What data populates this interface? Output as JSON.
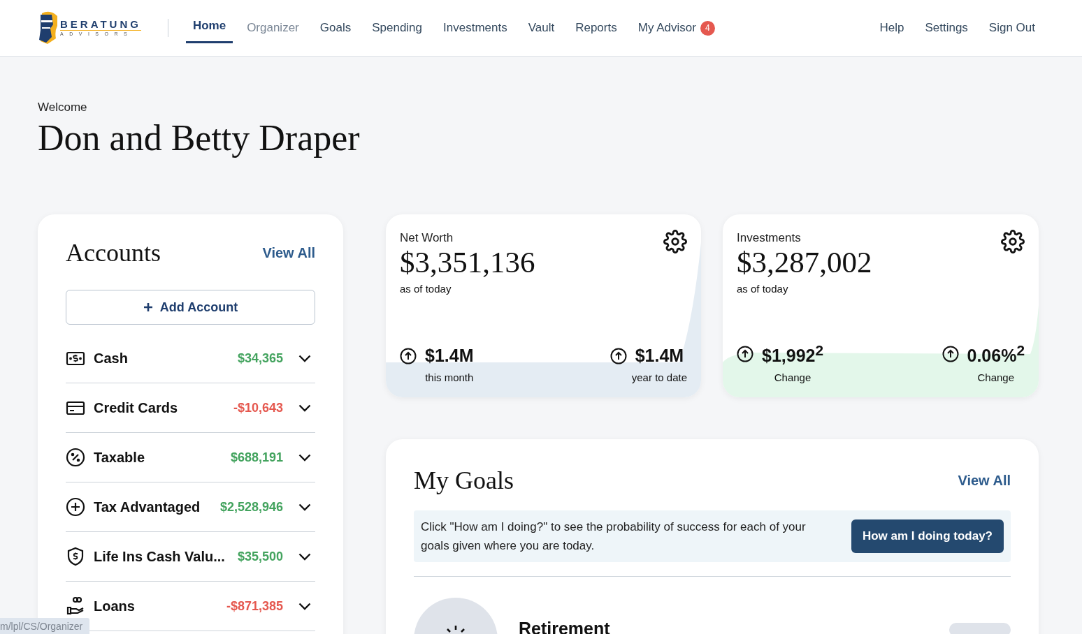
{
  "logo": {
    "name": "BERATUNG",
    "tagline": "ADVISORS"
  },
  "nav": [
    {
      "label": "Home",
      "selected": true,
      "hovered": false
    },
    {
      "label": "Organizer",
      "selected": false,
      "hovered": true
    },
    {
      "label": "Goals",
      "selected": false,
      "hovered": false
    },
    {
      "label": "Spending",
      "selected": false,
      "hovered": false
    },
    {
      "label": "Investments",
      "selected": false,
      "hovered": false
    },
    {
      "label": "Vault",
      "selected": false,
      "hovered": false
    },
    {
      "label": "Reports",
      "selected": false,
      "hovered": false
    },
    {
      "label": "My Advisor",
      "selected": false,
      "hovered": false,
      "badge": "4"
    }
  ],
  "nav_right": [
    "Help",
    "Settings",
    "Sign Out"
  ],
  "welcome": "Welcome",
  "household": "Don and Betty Draper",
  "accounts": {
    "title": "Accounts",
    "view_all": "View All",
    "add_button": "Add Account",
    "rows": [
      {
        "kind": "cash",
        "name": "Cash",
        "amount": "$34,365",
        "color": "#43a35e",
        "expanded": false
      },
      {
        "kind": "card",
        "name": "Credit Cards",
        "amount": "-$10,643",
        "color": "#e5584f",
        "expanded": false
      },
      {
        "kind": "taxable",
        "name": "Taxable",
        "amount": "$688,191",
        "color": "#43a35e",
        "expanded": false
      },
      {
        "kind": "advantaged",
        "name": "Tax Advantaged",
        "amount": "$2,528,946",
        "color": "#43a35e",
        "expanded": false
      },
      {
        "kind": "insurance",
        "name": "Life Ins Cash Valu...",
        "amount": "$35,500",
        "color": "#43a35e",
        "expanded": false
      },
      {
        "kind": "loan",
        "name": "Loans",
        "amount": "-$871,385",
        "color": "#e5584f",
        "expanded": false
      }
    ]
  },
  "summary_cards": [
    {
      "kind": "networth",
      "title": "Net Worth",
      "value": "$3,351,136",
      "note": "as of today",
      "stats": [
        {
          "value": "$1.4M",
          "label": "this month"
        },
        {
          "value": "$1.4M",
          "label": "year to date"
        }
      ]
    },
    {
      "kind": "investments",
      "title": "Investments",
      "value": "$3,287,002",
      "note": "as of today",
      "stats": [
        {
          "value": "$1,992$^{2}$",
          "label": "Change"
        },
        {
          "value": "0.06%$^{2}$",
          "label": "Change"
        }
      ]
    }
  ],
  "goals": {
    "title": "My Goals",
    "view_all": "View All",
    "info": "Click \"How am I doing?\" to see the probability of success for each of your goals given where you are today.",
    "button": "How am I doing today?",
    "items": [
      {
        "name": "Retirement"
      }
    ]
  },
  "status_url": "m/lpl/CS/Organizer"
}
